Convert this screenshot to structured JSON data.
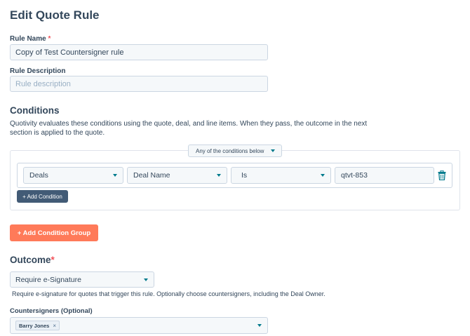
{
  "page": {
    "title": "Edit Quote Rule"
  },
  "rule_name": {
    "label": "Rule Name",
    "required_mark": "*",
    "value": "Copy of Test Countersigner rule"
  },
  "rule_description": {
    "label": "Rule Description",
    "placeholder": "Rule description"
  },
  "conditions": {
    "title": "Conditions",
    "description_line1": "Quotivity evaluates these conditions using the quote, deal, and line items. When they pass, the outcome in the next",
    "description_line2": "section is applied to the quote.",
    "group_match": "Any of the conditions below",
    "rows": [
      {
        "object": "Deals",
        "property": "Deal Name",
        "operator": "Is",
        "value": "qtvt-853"
      }
    ],
    "add_condition_label": "+ Add Condition",
    "add_group_label": "+ Add Condition Group"
  },
  "outcome": {
    "title": "Outcome",
    "required_mark": "*",
    "selected": "Require e-Signature",
    "help": "Require e-signature for quotes that trigger this rule. Optionally choose countersigners, including the Deal Owner."
  },
  "countersigners": {
    "label": "Countersigners (Optional)",
    "chips": [
      {
        "name": "Barry Jones",
        "remove": "×"
      }
    ]
  },
  "icons": {
    "dropdown": "chevron-down-icon",
    "delete": "trash-icon",
    "remove_chip": "close-icon"
  },
  "colors": {
    "primary_text": "#33475b",
    "accent_teal": "#007a8c",
    "dark_button": "#425b76",
    "orange_button": "#ff7a59",
    "required": "#f2545b",
    "input_bg": "#f5f8fa",
    "border": "#cbd6e2"
  }
}
